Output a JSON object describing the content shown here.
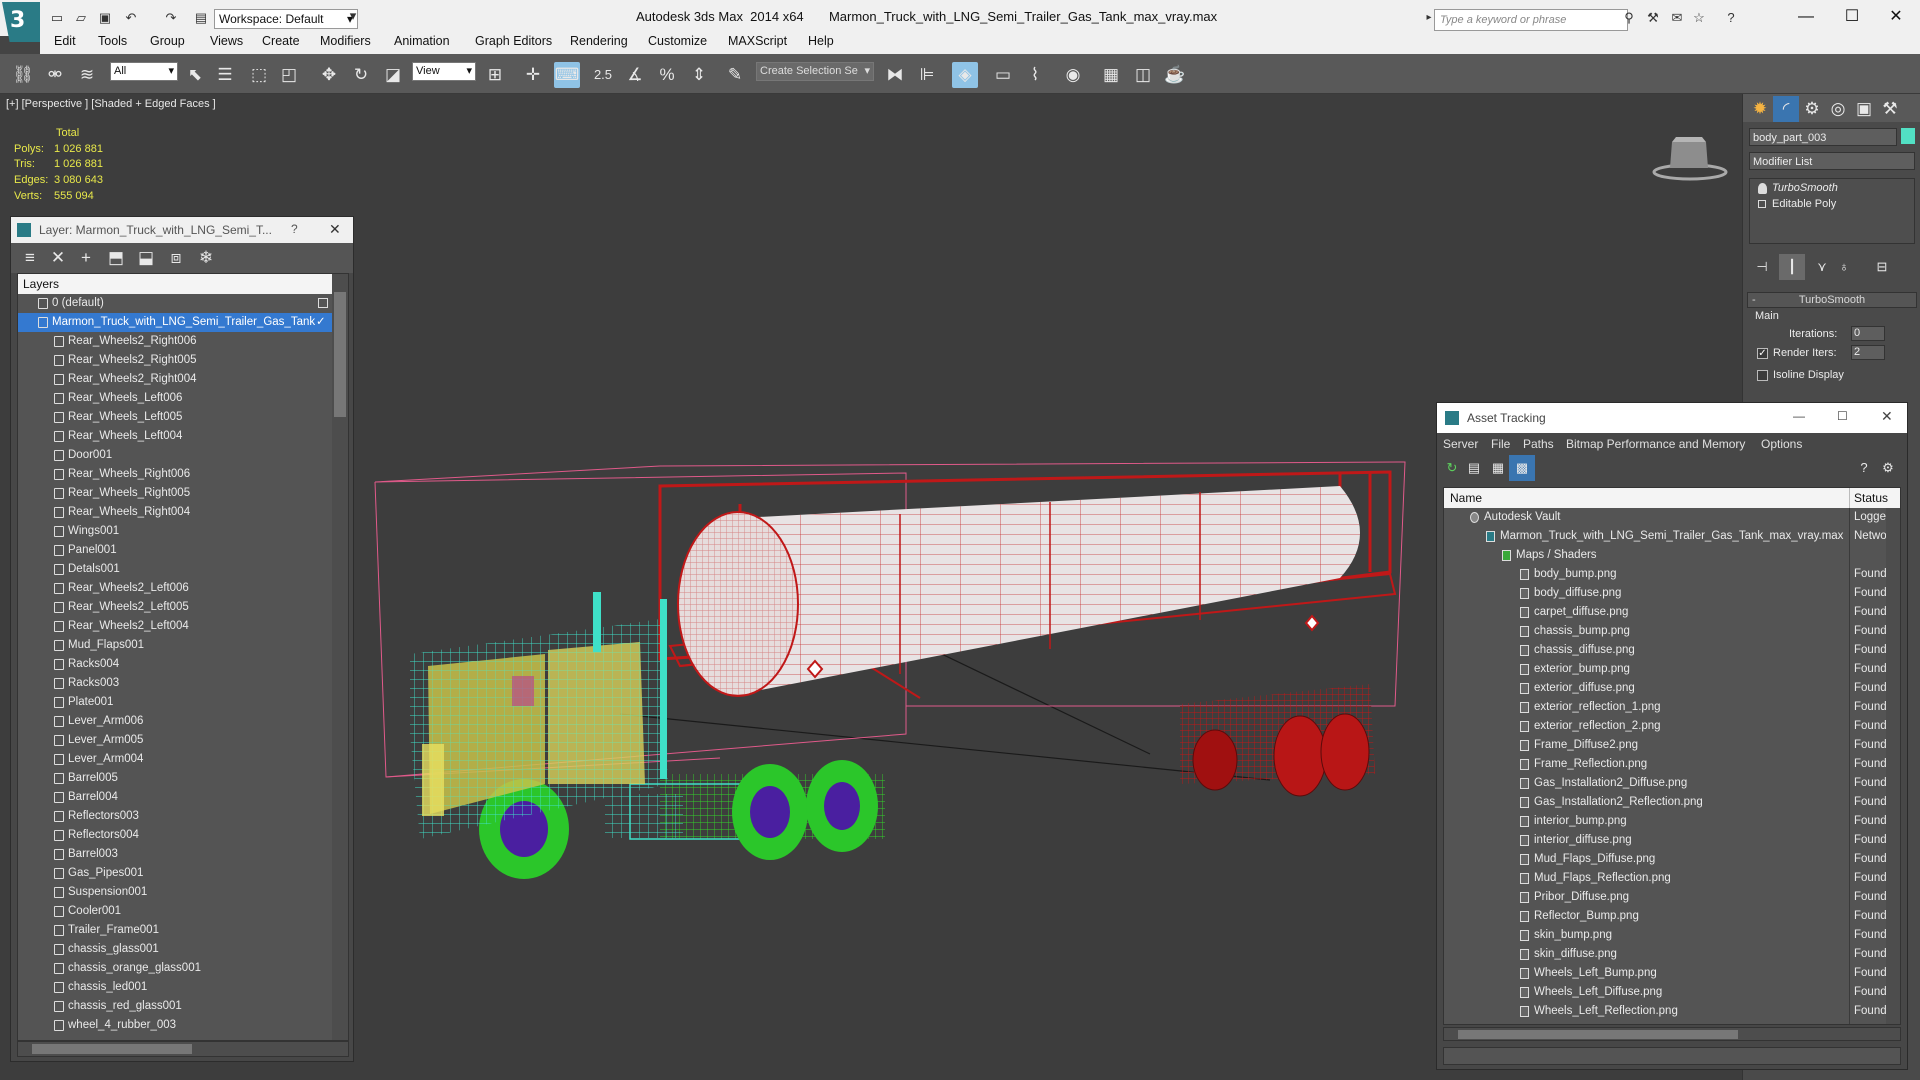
{
  "app": {
    "window_title": "Autodesk 3ds Max  2014 x64       Marmon_Truck_with_LNG_Semi_Trailer_Gas_Tank_max_vray.max",
    "workspace": "Workspace: Default",
    "search_placeholder": "Type a keyword or phrase",
    "logo_letter": "3"
  },
  "menu": [
    "Edit",
    "Tools",
    "Group",
    "Views",
    "Create",
    "Modifiers",
    "Graph Editors",
    "Animation",
    "Rendering",
    "Customize",
    "MAXScript",
    "Help"
  ],
  "toolbar": {
    "selection_filter": "All",
    "ref_coord": "View",
    "named_selection": "Create Selection Se",
    "snap_label": "2.5"
  },
  "viewport": {
    "label": "[+] [Perspective ] [Shaded + Edged Faces ]",
    "stats_header": "Total",
    "stats": [
      {
        "label": "Polys:",
        "value": "1 026 881"
      },
      {
        "label": "Tris:",
        "value": "1 026 881"
      },
      {
        "label": "Edges:",
        "value": "3 080 643"
      },
      {
        "label": "Verts:",
        "value": "555 094"
      }
    ]
  },
  "layer_window": {
    "title": "Layer: Marmon_Truck_with_LNG_Semi_T...",
    "help": "?",
    "header": "Layers",
    "default_layer": "0 (default)",
    "main_layer": "Marmon_Truck_with_LNG_Semi_Trailer_Gas_Tank",
    "objects": [
      "Rear_Wheels2_Right006",
      "Rear_Wheels2_Right005",
      "Rear_Wheels2_Right004",
      "Rear_Wheels_Left006",
      "Rear_Wheels_Left005",
      "Rear_Wheels_Left004",
      "Door001",
      "Rear_Wheels_Right006",
      "Rear_Wheels_Right005",
      "Rear_Wheels_Right004",
      "Wings001",
      "Panel001",
      "Detals001",
      "Rear_Wheels2_Left006",
      "Rear_Wheels2_Left005",
      "Rear_Wheels2_Left004",
      "Mud_Flaps001",
      "Racks004",
      "Racks003",
      "Plate001",
      "Lever_Arm006",
      "Lever_Arm005",
      "Lever_Arm004",
      "Barrel005",
      "Barrel004",
      "Reflectors003",
      "Reflectors004",
      "Barrel003",
      "Gas_Pipes001",
      "Suspension001",
      "Cooler001",
      "Trailer_Frame001",
      "chassis_glass001",
      "chassis_orange_glass001",
      "chassis_led001",
      "chassis_red_glass001",
      "wheel_4_rubber_003"
    ]
  },
  "command_panel": {
    "object_name": "body_part_003",
    "object_color": "#52e0c4",
    "modifier_list": "Modifier List",
    "stack": [
      "TurboSmooth",
      "Editable Poly"
    ],
    "rollout_title": "TurboSmooth",
    "group_main": "Main",
    "iterations_label": "Iterations:",
    "iterations_value": "0",
    "render_iters_label": "Render Iters:",
    "render_iters_value": "2",
    "isoline_label": "Isoline Display"
  },
  "asset_tracking": {
    "title": "Asset Tracking",
    "menu": [
      "Server",
      "File",
      "Paths",
      "Bitmap Performance and Memory",
      "Options"
    ],
    "col_name": "Name",
    "col_status": "Status",
    "vault": {
      "name": "Autodesk Vault",
      "status": "Logged"
    },
    "scene": {
      "name": "Marmon_Truck_with_LNG_Semi_Trailer_Gas_Tank_max_vray.max",
      "status": "Networ"
    },
    "maps_group": "Maps / Shaders",
    "files": [
      {
        "name": "body_bump.png",
        "status": "Found"
      },
      {
        "name": "body_diffuse.png",
        "status": "Found"
      },
      {
        "name": "carpet_diffuse.png",
        "status": "Found"
      },
      {
        "name": "chassis_bump.png",
        "status": "Found"
      },
      {
        "name": "chassis_diffuse.png",
        "status": "Found"
      },
      {
        "name": "exterior_bump.png",
        "status": "Found"
      },
      {
        "name": "exterior_diffuse.png",
        "status": "Found"
      },
      {
        "name": "exterior_reflection_1.png",
        "status": "Found"
      },
      {
        "name": "exterior_reflection_2.png",
        "status": "Found"
      },
      {
        "name": "Frame_Diffuse2.png",
        "status": "Found"
      },
      {
        "name": "Frame_Reflection.png",
        "status": "Found"
      },
      {
        "name": "Gas_Installation2_Diffuse.png",
        "status": "Found"
      },
      {
        "name": "Gas_Installation2_Reflection.png",
        "status": "Found"
      },
      {
        "name": "interior_bump.png",
        "status": "Found"
      },
      {
        "name": "interior_diffuse.png",
        "status": "Found"
      },
      {
        "name": "Mud_Flaps_Diffuse.png",
        "status": "Found"
      },
      {
        "name": "Mud_Flaps_Reflection.png",
        "status": "Found"
      },
      {
        "name": "Pribor_Diffuse.png",
        "status": "Found"
      },
      {
        "name": "Reflector_Bump.png",
        "status": "Found"
      },
      {
        "name": "skin_bump.png",
        "status": "Found"
      },
      {
        "name": "skin_diffuse.png",
        "status": "Found"
      },
      {
        "name": "Wheels_Left_Bump.png",
        "status": "Found"
      },
      {
        "name": "Wheels_Left_Diffuse.png",
        "status": "Found"
      },
      {
        "name": "Wheels_Left_Reflection.png",
        "status": "Found"
      }
    ]
  },
  "colors": {
    "cab_wire": "#3fe0c8",
    "chassis_wire": "#34d42a",
    "trailer_wire": "#c01818",
    "bbox": "#e05a8a",
    "selection": "#3479d0"
  }
}
